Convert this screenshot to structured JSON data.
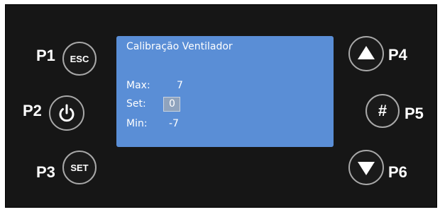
{
  "buttons": {
    "p1": {
      "label": "P1",
      "text": "ESC"
    },
    "p2": {
      "label": "P2",
      "icon": "power-icon"
    },
    "p3": {
      "label": "P3",
      "text": "SET"
    },
    "p4": {
      "label": "P4",
      "icon": "arrow-up-icon"
    },
    "p5": {
      "label": "P5",
      "text": "#"
    },
    "p6": {
      "label": "P6",
      "icon": "arrow-down-icon"
    }
  },
  "screen": {
    "title": "Calibração Ventilador",
    "max_label": "Max:",
    "max_value": "7",
    "set_label": "Set:",
    "set_value": "0",
    "min_label": "Min:",
    "min_value": "-7"
  },
  "colors": {
    "panel": "#161616",
    "screen": "#5a8ed6",
    "button_border": "#a8a8a8"
  }
}
